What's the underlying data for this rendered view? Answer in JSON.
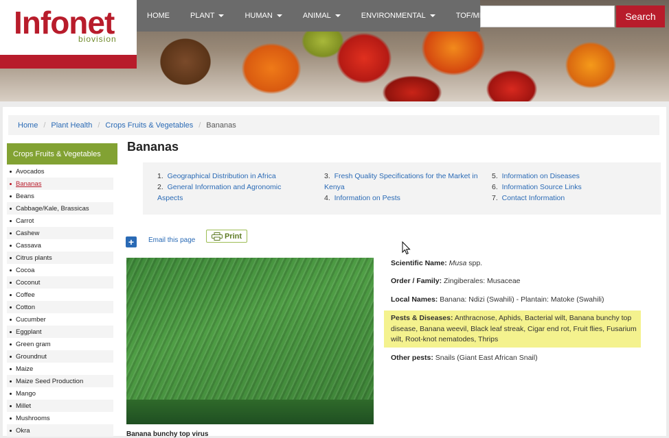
{
  "header": {
    "logo": {
      "main": "Infonet",
      "sub": "biovision"
    },
    "nav": [
      {
        "label": "HOME",
        "dropdown": false
      },
      {
        "label": "PLANT",
        "dropdown": true
      },
      {
        "label": "HUMAN",
        "dropdown": true
      },
      {
        "label": "ANIMAL",
        "dropdown": true
      },
      {
        "label": "ENVIRONMENTAL",
        "dropdown": true
      },
      {
        "label": "TOF/MKM",
        "dropdown": false
      }
    ],
    "search": {
      "placeholder": "",
      "button": "Search"
    }
  },
  "breadcrumb": {
    "items": [
      "Home",
      "Plant Health",
      "Crops Fruits & Vegetables"
    ],
    "current": "Bananas"
  },
  "sidebar": {
    "title": "Crops Fruits & Vegetables",
    "items": [
      "Avocados",
      "Bananas",
      "Beans",
      "Cabbage/Kale, Brassicas",
      "Carrot",
      "Cashew",
      "Cassava",
      "Citrus plants",
      "Cocoa",
      "Coconut",
      "Coffee",
      "Cotton",
      "Cucumber",
      "Eggplant",
      "Green gram",
      "Groundnut",
      "Maize",
      "Maize Seed Production",
      "Mango",
      "Millet",
      "Mushrooms",
      "Okra"
    ],
    "active": "Bananas"
  },
  "page": {
    "title": "Bananas",
    "toc": [
      {
        "num": "1.",
        "label": "Geographical Distribution in Africa"
      },
      {
        "num": "2.",
        "label": "General Information and Agronomic Aspects"
      },
      {
        "num": "3.",
        "label": "Fresh Quality Specifications for the Market in Kenya"
      },
      {
        "num": "4.",
        "label": "Information on Pests"
      },
      {
        "num": "5.",
        "label": "Information on Diseases"
      },
      {
        "num": "6.",
        "label": "Information Source Links"
      },
      {
        "num": "7.",
        "label": "Contact Information"
      }
    ],
    "share": {
      "email": "Email this page",
      "print": "Print"
    },
    "image_caption": "Banana bunchy top virus",
    "info": {
      "scientific_label": "Scientific Name:",
      "scientific_genus": "Musa",
      "scientific_rest": "spp.",
      "family_label": "Order / Family:",
      "family_value": "Zingiberales: Musaceae",
      "local_label": "Local Names:",
      "local_value": "Banana: Ndizi (Swahili) - Plantain: Matoke (Swahili)",
      "pests_label": "Pests & Diseases:",
      "pests_value": "Anthracnose, Aphids, Bacterial wilt, Banana bunchy top disease, Banana weevil, Black leaf streak, Cigar end rot, Fruit flies, Fusarium wilt, Root-knot nematodes, Thrips",
      "other_label": "Other pests:",
      "other_value": "Snails (Giant East African Snail)"
    }
  },
  "colors": {
    "brand_red": "#b81c2b",
    "brand_green": "#82a233",
    "link_blue": "#2a6ab5",
    "highlight": "#f4f28e",
    "nav_grey": "#6b6b6b"
  }
}
